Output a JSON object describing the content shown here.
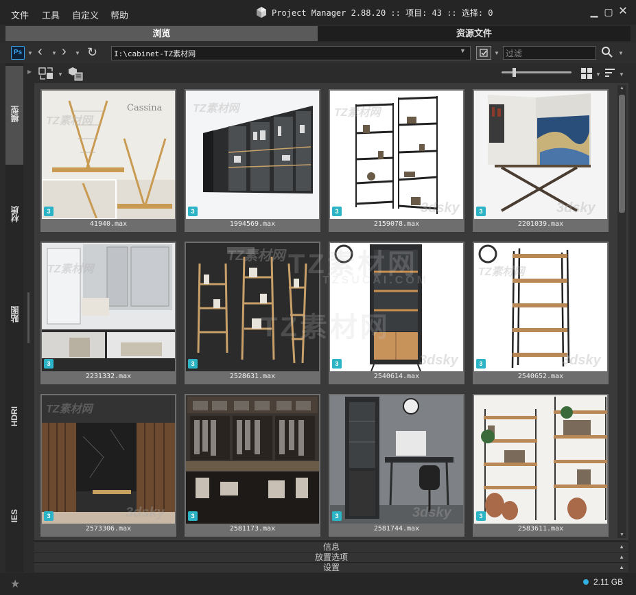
{
  "menu": [
    "文件",
    "工具",
    "自定义",
    "帮助"
  ],
  "title": "Project Manager 2.88.20  :: 项目: 43  :: 选择: 0",
  "tabs": {
    "browse": "浏览",
    "assets": "资源文件"
  },
  "toolbar": {
    "ps_label": "Ps",
    "path": "I:\\cabinet-TZ素材网",
    "filter_placeholder": "过滤"
  },
  "side_tabs": [
    "模型",
    "材质",
    "贴图",
    "HDRI",
    "IES"
  ],
  "items": [
    {
      "name": "41940.max",
      "badge": "3"
    },
    {
      "name": "1994569.max",
      "badge": "3"
    },
    {
      "name": "2159078.max",
      "badge": "3"
    },
    {
      "name": "2201039.max",
      "badge": "3"
    },
    {
      "name": "2231332.max",
      "badge": "3"
    },
    {
      "name": "2528631.max",
      "badge": "3"
    },
    {
      "name": "2540614.max",
      "badge": "3"
    },
    {
      "name": "2540652.max",
      "badge": "3"
    },
    {
      "name": "2573306.max",
      "badge": "3"
    },
    {
      "name": "2581173.max",
      "badge": "3"
    },
    {
      "name": "2581744.max",
      "badge": "3"
    },
    {
      "name": "2583611.max",
      "badge": "3"
    }
  ],
  "panels": {
    "info": "信息",
    "placement": "放置选项",
    "settings": "设置"
  },
  "status": {
    "disk": "2.11 GB"
  },
  "watermarks": {
    "tz": "TZ素材网",
    "site": "TZSUCAI.COM",
    "threed": "3dsky",
    "cassina": "Cassina"
  }
}
